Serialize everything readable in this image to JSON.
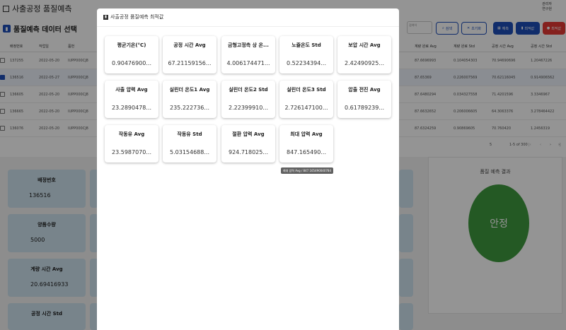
{
  "app": {
    "title": "사출공정 품질예측",
    "user_name": "관리자",
    "user_role": "연구원"
  },
  "subheader": {
    "title": "품질예측 데이터 선택",
    "search_placeholder": "검색어",
    "buttons": {
      "search": "검색",
      "reset": "초기화",
      "detail": "예측",
      "apply": "최적값",
      "delete": "최적값"
    }
  },
  "table": {
    "headers": [
      "배정번호",
      "작업일",
      "품번",
      "계량 완료 Avg",
      "계량 완료 Std",
      "공정 시간 Avg",
      "공정 시간 Std"
    ],
    "rows": [
      {
        "id": "137255",
        "date": "2022-05-20",
        "part": "IUPP000CJ8",
        "c1": "87.6696993",
        "c2": "0.104054303",
        "c3": "70.94690696",
        "c4": "1.20467226",
        "checked": false
      },
      {
        "id": "136516",
        "date": "2022-05-27",
        "part": "IUPP000CJ8",
        "c1": "87.65369",
        "c2": "0.226007569",
        "c3": "70.62116045",
        "c4": "0.914906562",
        "checked": true
      },
      {
        "id": "136605",
        "date": "2022-05-20",
        "part": "IUPP000CJ8",
        "c1": "87.6480294",
        "c2": "0.034327558",
        "c3": "71.4201596",
        "c4": "3.3346967",
        "checked": false
      },
      {
        "id": "136665",
        "date": "2022-05-20",
        "part": "IUPP000CJ8",
        "c1": "87.6632652",
        "c2": "0.206006605",
        "c3": "64.3063376",
        "c4": "3.278464422",
        "checked": false
      },
      {
        "id": "136076",
        "date": "2022-05-20",
        "part": "IUPP000CJ8",
        "c1": "87.6324259",
        "c2": "0.90869605",
        "c3": "70.760420",
        "c4": "1.2456319",
        "checked": false
      }
    ],
    "pagination": {
      "rows_per_page": "5",
      "range": "1-5 of 300"
    }
  },
  "lower": {
    "cards": [
      {
        "label": "배정번호",
        "value": "136516"
      },
      {
        "label": "양품수량",
        "value": "5000"
      },
      {
        "label": "계량 시간 Avg",
        "value": "20.69416933"
      },
      {
        "label": "공정 시간 Std",
        "value": ""
      }
    ],
    "result_title": "품질 예측 결과",
    "result_value": "안정",
    "result_color": "#3f9a3f"
  },
  "modal": {
    "title": "사출공정 품질예측 최적값",
    "params": [
      {
        "name": "평균기온(°C)",
        "value": "0.90476900..."
      },
      {
        "name": "공정 시간 Avg",
        "value": "67.21159156..."
      },
      {
        "name": "금형고정측 상 온...",
        "value": "4.006174471..."
      },
      {
        "name": "노즐온도 Std",
        "value": "0.52234394..."
      },
      {
        "name": "보압 시간 Avg",
        "value": "2.42490925..."
      },
      {
        "name": "사출 압력 Avg",
        "value": "23.2890478..."
      },
      {
        "name": "실린더 온도1 Avg",
        "value": "235.222736..."
      },
      {
        "name": "실린더 온도2 Std",
        "value": "2.22399910..."
      },
      {
        "name": "실린더 온도3 Std",
        "value": "2.726147100..."
      },
      {
        "name": "압출 전진 Avg",
        "value": "0.61789239..."
      },
      {
        "name": "작동유 Avg",
        "value": "23.5987070..."
      },
      {
        "name": "작동유 Std",
        "value": "5.03154688..."
      },
      {
        "name": "절환 압력 Avg",
        "value": "924.718025..."
      },
      {
        "name": "최대 압력 Avg",
        "value": "847.165490..."
      }
    ],
    "tooltip": "최대 압력 Avg / 847.165490040784"
  },
  "colors": {
    "accent": "#1e4fb8",
    "danger": "#e53935",
    "card_bg": "#cfe3ef"
  }
}
